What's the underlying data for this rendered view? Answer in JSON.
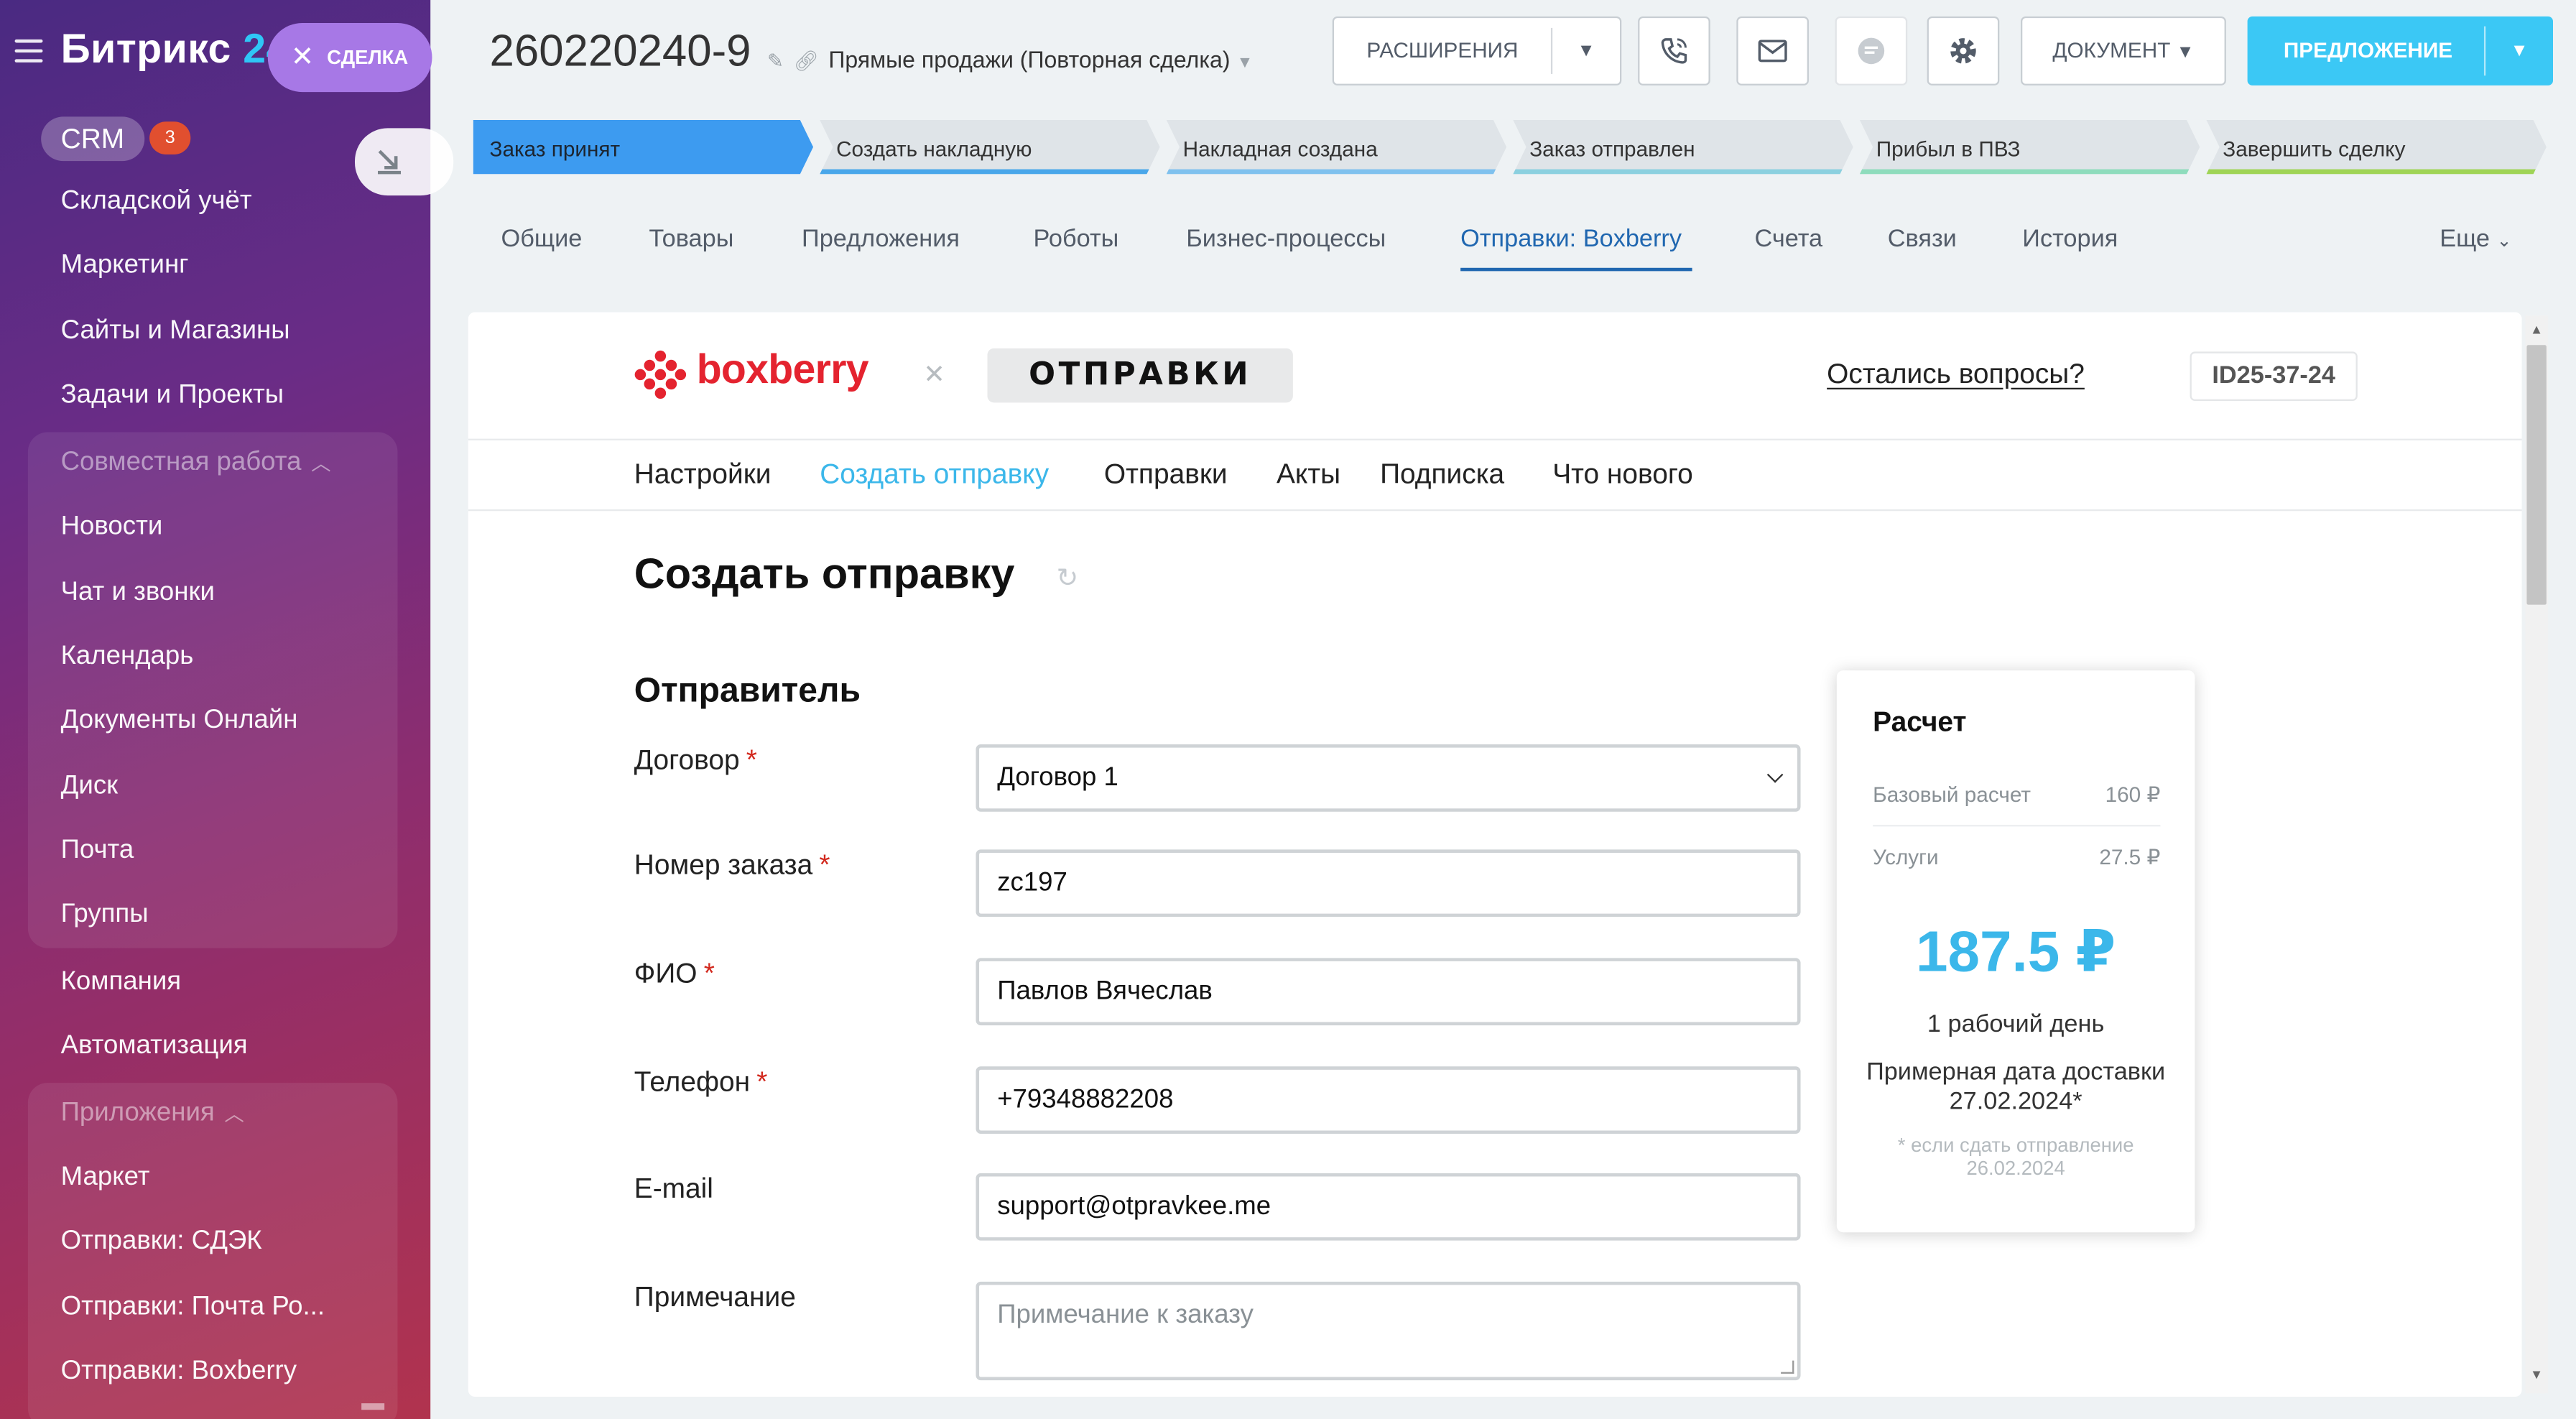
{
  "sidebar": {
    "logo_text": "Битрикс",
    "logo_suffix": "24",
    "crm_label": "CRM",
    "crm_badge": "3",
    "items": [
      "Складской учёт",
      "Маркетинг",
      "Сайты и Магазины",
      "Задачи и Проекты"
    ],
    "group_collab": "Совместная работа",
    "collab_items": [
      "Новости",
      "Чат и звонки",
      "Календарь",
      "Документы Онлайн",
      "Диск",
      "Почта",
      "Группы"
    ],
    "mid_items": [
      "Компания",
      "Автоматизация"
    ],
    "group_apps": "Приложения",
    "apps_items": [
      "Маркет",
      "Отправки: СДЭК",
      "Отправки: Почта Ро...",
      "Отправки: Boxberry"
    ]
  },
  "deal_pill": "СДЕЛКА",
  "header": {
    "deal_id": "260220240-9",
    "deal_type": "Прямые продажи (Повторная сделка)",
    "btn_extensions": "РАСШИРЕНИЯ",
    "btn_document": "ДОКУМЕНТ",
    "btn_offer": "ПРЕДЛОЖЕНИЕ"
  },
  "stages": [
    {
      "label": "Заказ принят",
      "color": "#3d9bf0"
    },
    {
      "label": "Создать накладную",
      "color": "#49a7ea"
    },
    {
      "label": "Накладная создана",
      "color": "#7fc1ee"
    },
    {
      "label": "Заказ отправлен",
      "color": "#8bd0df"
    },
    {
      "label": "Прибыл в ПВЗ",
      "color": "#8edcbc"
    },
    {
      "label": "Завершить сделку",
      "color": "#9fd455"
    }
  ],
  "tabs": [
    "Общие",
    "Товары",
    "Предложения",
    "Роботы",
    "Бизнес-процессы",
    "Отправки: Boxberry",
    "Счета",
    "Связи",
    "История"
  ],
  "tab_more": "Еще",
  "app": {
    "brand": "boxberry",
    "partner": "ОТПРАВКИ",
    "help": "Остались вопросы?",
    "account_id": "ID25-37-24",
    "nav": [
      "Настройки",
      "Создать отправку",
      "Отправки",
      "Акты",
      "Подписка",
      "Что нового"
    ],
    "page_title": "Создать отправку",
    "section_title": "Отправитель",
    "fields": {
      "contract": {
        "label": "Договор",
        "value": "Договор 1"
      },
      "order": {
        "label": "Номер заказа",
        "value": "zc197"
      },
      "name": {
        "label": "ФИО",
        "value": "Павлов Вячеслав"
      },
      "phone": {
        "label": "Телефон",
        "value": "+79348882208"
      },
      "email": {
        "label": "E-mail",
        "value": "support@otpravkee.me"
      },
      "note": {
        "label": "Примечание",
        "placeholder": "Примечание к заказу"
      }
    },
    "calc": {
      "title": "Расчет",
      "base_label": "Базовый расчет",
      "base_value": "160 ₽",
      "services_label": "Услуги",
      "services_value": "27.5 ₽",
      "total": "187.5 ₽",
      "days": "1 рабочий день",
      "est_date": "Примерная дата доставки 27.02.2024*",
      "footnote": "* если сдать отправление 26.02.2024"
    }
  }
}
